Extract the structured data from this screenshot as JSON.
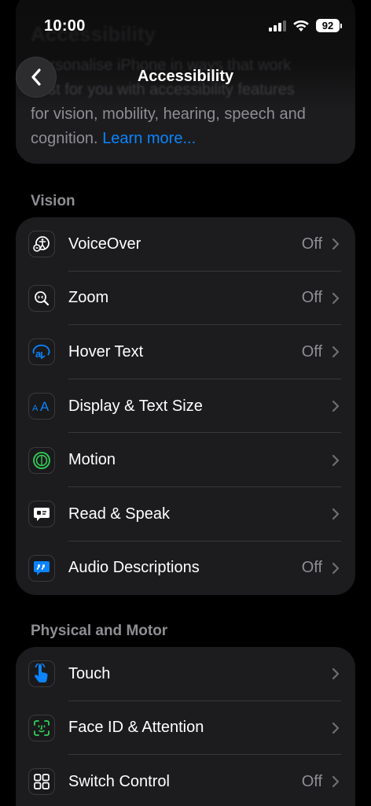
{
  "status_bar": {
    "time": "10:00",
    "battery": "92"
  },
  "header": {
    "title": "Accessibility",
    "ghost_title": "Accessibility",
    "intro_lines": [
      "Personalise iPhone in ways that work",
      "best for you with accessibility features",
      "for vision, mobility, hearing, speech and"
    ],
    "intro_last": "cognition.",
    "learn_more": "Learn more..."
  },
  "sections": {
    "vision": {
      "title": "Vision",
      "items": [
        {
          "label": "VoiceOver",
          "value": "Off",
          "icon": "voiceover-icon"
        },
        {
          "label": "Zoom",
          "value": "Off",
          "icon": "zoom-icon"
        },
        {
          "label": "Hover Text",
          "value": "Off",
          "icon": "hover-text-icon"
        },
        {
          "label": "Display & Text Size",
          "value": "",
          "icon": "text-size-icon"
        },
        {
          "label": "Motion",
          "value": "",
          "icon": "motion-icon"
        },
        {
          "label": "Read & Speak",
          "value": "",
          "icon": "read-speak-icon"
        },
        {
          "label": "Audio Descriptions",
          "value": "Off",
          "icon": "audio-descriptions-icon"
        }
      ]
    },
    "physical": {
      "title": "Physical and Motor",
      "items": [
        {
          "label": "Touch",
          "value": "",
          "icon": "touch-icon"
        },
        {
          "label": "Face ID & Attention",
          "value": "",
          "icon": "face-id-icon"
        },
        {
          "label": "Switch Control",
          "value": "Off",
          "icon": "switch-control-icon"
        }
      ]
    }
  },
  "colors": {
    "accent": "#0a84ff",
    "background": "#000000",
    "group": "#1c1c1e",
    "secondary_text": "#8e8e93",
    "motion_green": "#30d158"
  }
}
